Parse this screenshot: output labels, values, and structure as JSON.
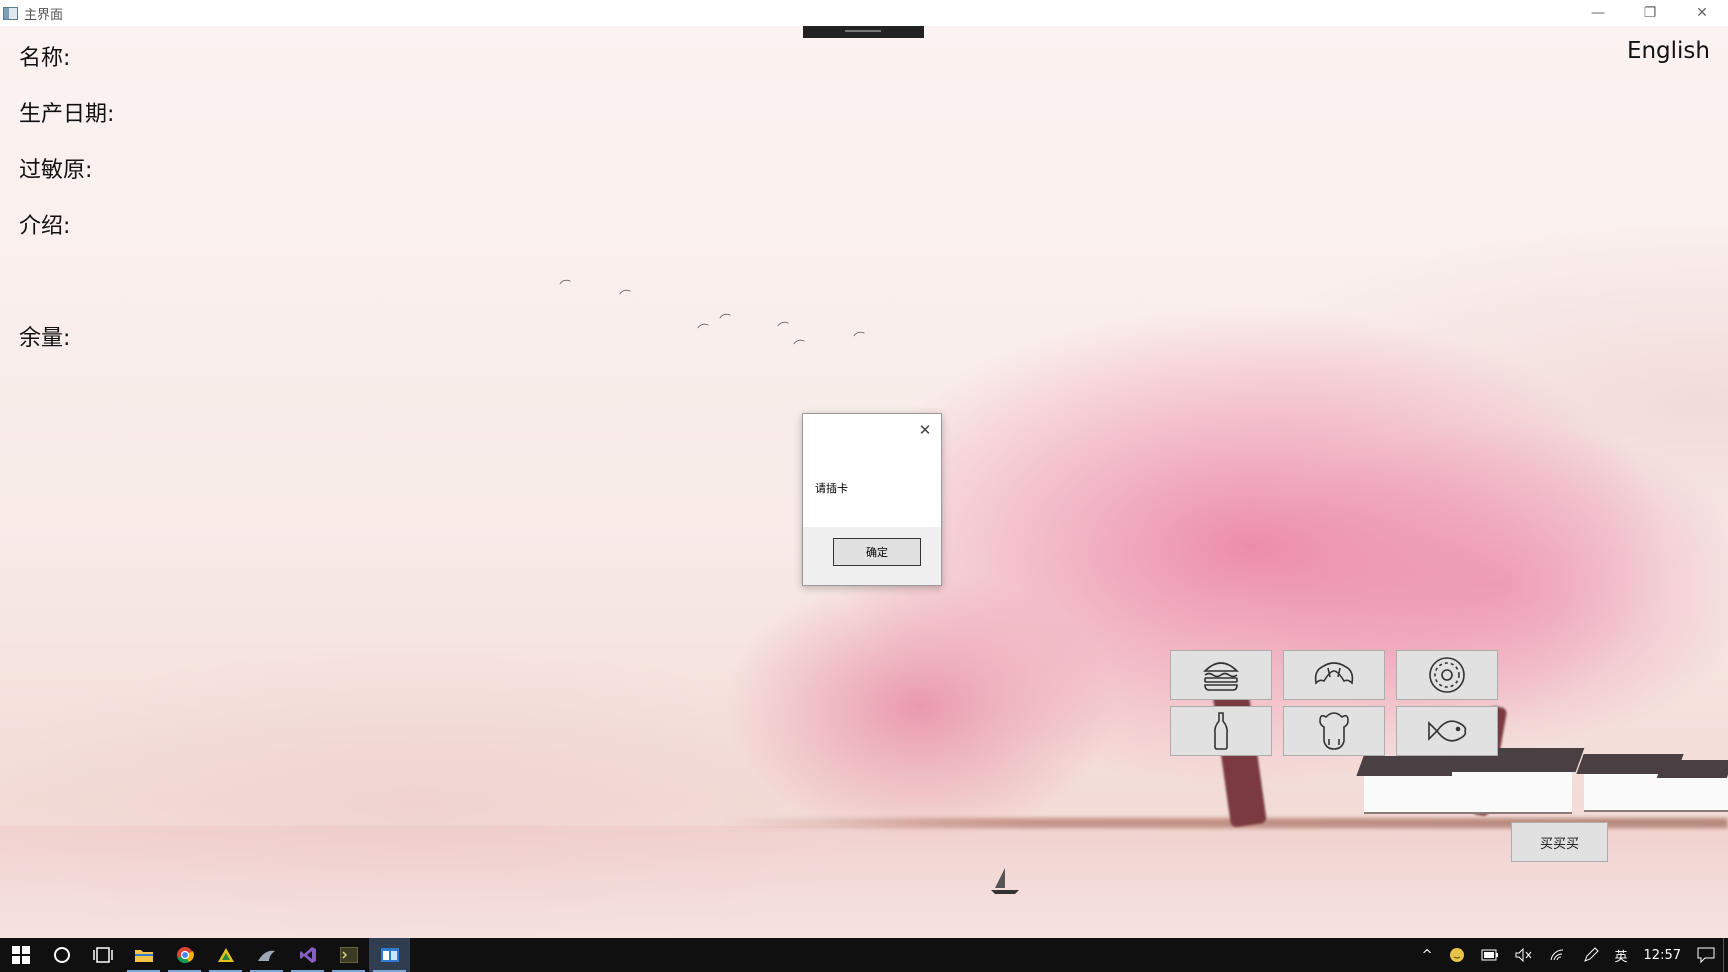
{
  "window": {
    "title": "主界面",
    "minimize_glyph": "—",
    "restore_glyph": "❐",
    "close_glyph": "✕"
  },
  "fields": {
    "name": "名称:",
    "production_date": "生产日期:",
    "allergens": "过敏原:",
    "introduction": "介绍:",
    "remaining": "余量:"
  },
  "language_toggle": "English",
  "products": [
    {
      "icon": "burger-icon"
    },
    {
      "icon": "croissant-icon"
    },
    {
      "icon": "donut-icon"
    },
    {
      "icon": "bottle-icon"
    },
    {
      "icon": "chicken-icon"
    },
    {
      "icon": "fish-icon"
    }
  ],
  "buy_button": "买买买",
  "dialog": {
    "message": "请插卡",
    "ok_label": "确定",
    "close_glyph": "✕"
  },
  "taskbar": {
    "apps": [
      "start-icon",
      "search-icon",
      "task-view-icon",
      "file-explorer-icon",
      "chrome-icon",
      "app-icon",
      "network-tool-icon",
      "visual-studio-icon",
      "terminal-icon",
      "main-app-icon"
    ],
    "tray": {
      "chevron": "^",
      "ime": "英",
      "time": "12:57"
    }
  },
  "colors": {
    "taskbar_bg": "#101010",
    "button_bg": "#e1e1e1",
    "blossom_pink": "#e86e96"
  }
}
